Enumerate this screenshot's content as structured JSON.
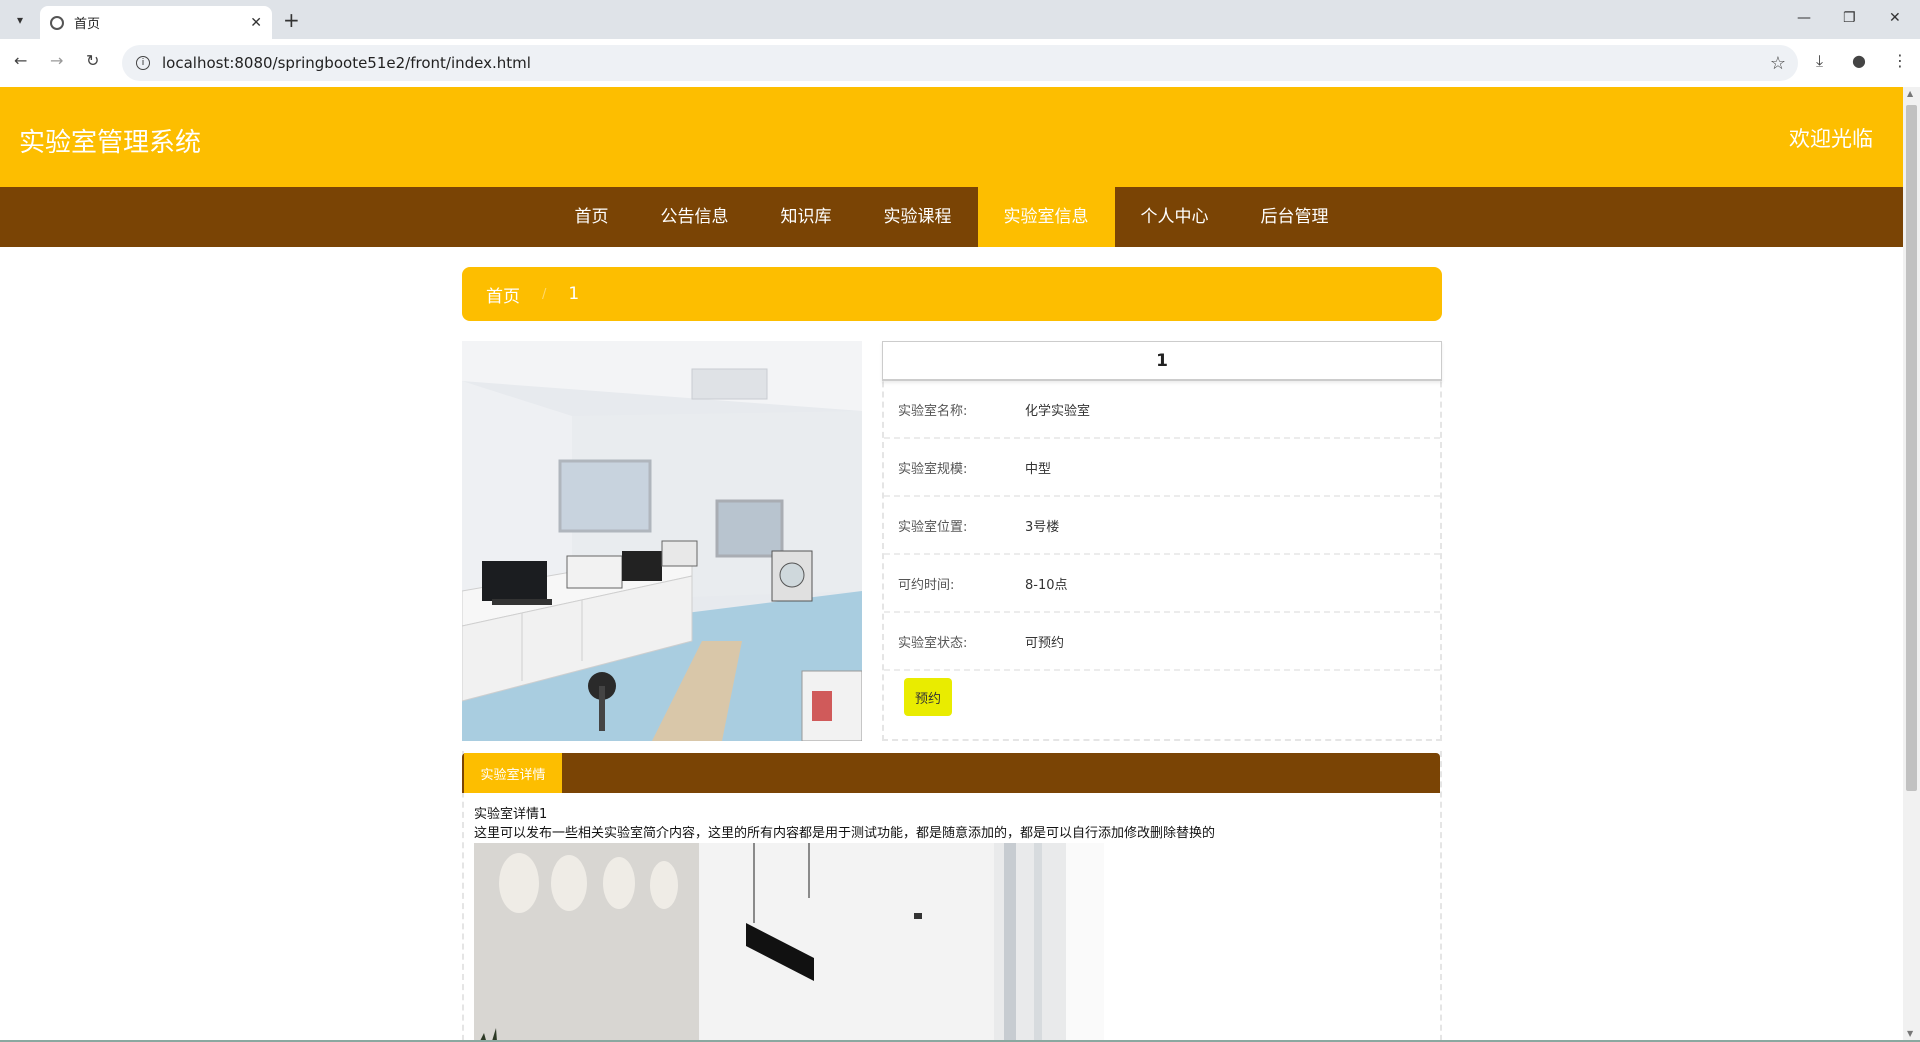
{
  "browser": {
    "tab_title": "首页",
    "url": "localhost:8080/springboote51e2/front/index.html"
  },
  "header": {
    "site_title": "实验室管理系统",
    "welcome": "欢迎光临"
  },
  "nav": {
    "items": [
      {
        "label": "首页"
      },
      {
        "label": "公告信息"
      },
      {
        "label": "知识库"
      },
      {
        "label": "实验课程"
      },
      {
        "label": "实验室信息",
        "active": true
      },
      {
        "label": "个人中心"
      },
      {
        "label": "后台管理"
      }
    ]
  },
  "breadcrumb": {
    "home": "首页",
    "separator": "/",
    "current": "1"
  },
  "lab": {
    "title": "1",
    "fields": [
      {
        "label": "实验室名称:",
        "value": "化学实验室"
      },
      {
        "label": "实验室规模:",
        "value": "中型"
      },
      {
        "label": "实验室位置:",
        "value": "3号楼"
      },
      {
        "label": "可约时间:",
        "value": "8-10点"
      },
      {
        "label": "实验室状态:",
        "value": "可预约"
      }
    ],
    "reserve_label": "预约"
  },
  "detail": {
    "tab_label": "实验室详情",
    "line1": "实验室详情1",
    "line2": "这里可以发布一些相关实验室简介内容，这里的所有内容都是用于测试功能，都是随意添加的，都是可以自行添加修改删除替换的"
  },
  "colors": {
    "brand_yellow": "#fdbe00",
    "nav_brown": "#7a4405",
    "reserve_button": "#e9ec00"
  }
}
